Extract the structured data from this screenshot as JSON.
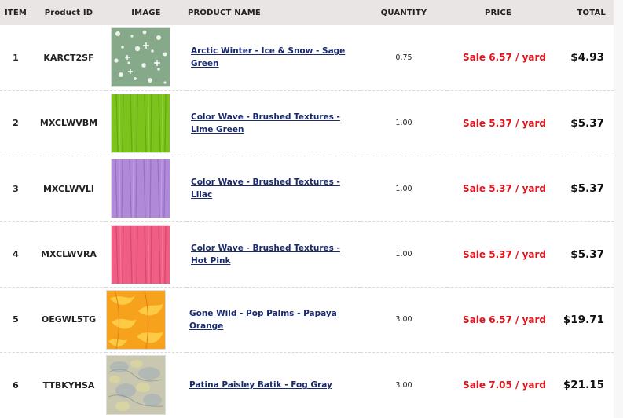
{
  "headers": {
    "item": "ITEM",
    "pid": "Product ID",
    "image": "IMAGE",
    "name": "PRODUCT NAME",
    "qty": "QUANTITY",
    "price": "PRICE",
    "total": "TOTAL"
  },
  "rows": [
    {
      "item": "1",
      "pid": "KARCT2SF",
      "name": "Arctic Winter - Ice & Snow - Sage Green",
      "qty": "0.75",
      "price": "Sale 6.57 / yard",
      "total": "$4.93",
      "swatch": "sage-green-snowflake"
    },
    {
      "item": "2",
      "pid": "MXCLWVBM",
      "name": "Color Wave - Brushed Textures - Lime Green",
      "qty": "1.00",
      "price": "Sale 5.37 / yard",
      "total": "$5.37",
      "swatch": "lime-green-brushed"
    },
    {
      "item": "3",
      "pid": "MXCLWVLI",
      "name": "Color Wave - Brushed Textures - Lilac",
      "qty": "1.00",
      "price": "Sale 5.37 / yard",
      "total": "$5.37",
      "swatch": "lilac-brushed"
    },
    {
      "item": "4",
      "pid": "MXCLWVRA",
      "name": "Color Wave - Brushed Textures - Hot Pink",
      "qty": "1.00",
      "price": "Sale 5.37 / yard",
      "total": "$5.37",
      "swatch": "hot-pink-brushed"
    },
    {
      "item": "5",
      "pid": "OEGWL5TG",
      "name": "Gone Wild - Pop Palms - Papaya Orange",
      "qty": "3.00",
      "price": "Sale 6.57 / yard",
      "total": "$19.71",
      "swatch": "papaya-orange-palms"
    },
    {
      "item": "6",
      "pid": "TTBKYHSA",
      "name": "Patina Paisley Batik - Fog Gray",
      "qty": "3.00",
      "price": "Sale 7.05 / yard",
      "total": "$21.15",
      "swatch": "fog-gray-batik"
    }
  ],
  "colors": {
    "header_bg": "#e9e5e5",
    "link": "#1a2a6c",
    "sale_red": "#e0131b"
  }
}
